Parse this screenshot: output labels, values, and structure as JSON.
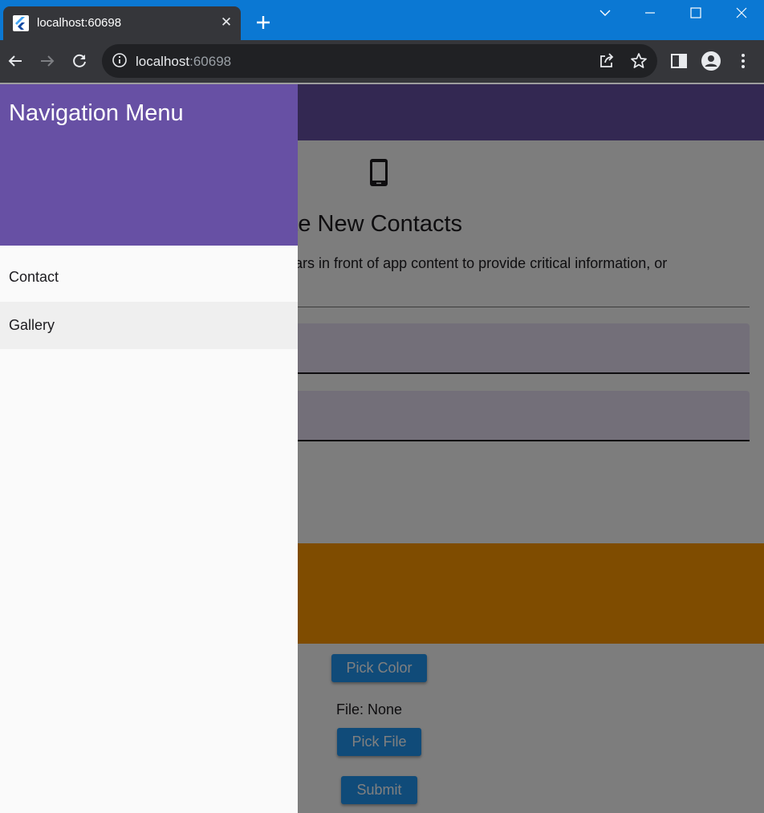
{
  "browser": {
    "tab": {
      "title": "localhost:60698",
      "close_symbol": "✕"
    },
    "address": {
      "host": "localhost",
      "port": ":60698"
    },
    "icons": {
      "favicon": "flutter-favicon",
      "new_tab": "plus-icon",
      "minimize": "minimize-icon",
      "maximize": "maximize-icon",
      "close": "close-icon",
      "back": "back-arrow-icon",
      "forward": "forward-arrow-icon",
      "reload": "reload-icon",
      "site_info": "info-icon",
      "share": "share-icon",
      "bookmark": "star-icon",
      "side_panel": "side-panel-icon",
      "profile": "profile-icon",
      "menu": "kebab-menu-icon"
    }
  },
  "app": {
    "page_title": "eate New Contacts",
    "description": "pears in front of app content to provide critical information, or",
    "file_label": "File: None",
    "buttons": {
      "pick_color": "Pick Color",
      "pick_file": "Pick File",
      "submit": "Submit"
    },
    "colors": {
      "primary": "#6750a4",
      "accent_orange": "#ff9800",
      "button_blue": "#2196f3"
    }
  },
  "drawer": {
    "title": "Navigation Menu",
    "items": [
      {
        "label": "Contact"
      },
      {
        "label": "Gallery"
      }
    ]
  }
}
